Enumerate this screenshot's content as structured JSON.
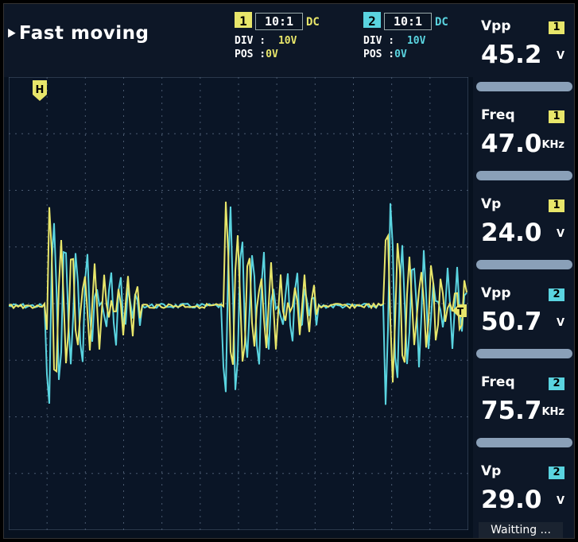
{
  "header": {
    "trigger_mode": "Fast moving",
    "channels": [
      {
        "id": "1",
        "probe": "10:1",
        "coupling": "DC",
        "div_label": "DIV :",
        "div_value": "10V",
        "pos_label": "POS :",
        "pos_value": "0V",
        "color": "#e8e66a"
      },
      {
        "id": "2",
        "probe": "10:1",
        "coupling": "DC",
        "div_label": "DIV :",
        "div_value": "10V",
        "pos_label": "POS :",
        "pos_value": "0V",
        "color": "#5ad4e0"
      }
    ]
  },
  "markers": {
    "horizontal": "H",
    "trigger": "T"
  },
  "measurements": [
    {
      "label": "Vpp",
      "channel": "1",
      "value": "45.2",
      "unit": "V",
      "color": "#e8e66a"
    },
    {
      "label": "Freq",
      "channel": "1",
      "value": "47.0",
      "unit": "KHz",
      "color": "#e8e66a"
    },
    {
      "label": "Vp",
      "channel": "1",
      "value": "24.0",
      "unit": "V",
      "color": "#e8e66a"
    },
    {
      "label": "Vpp",
      "channel": "2",
      "value": "50.7",
      "unit": "V",
      "color": "#5ad4e0"
    },
    {
      "label": "Freq",
      "channel": "2",
      "value": "75.7",
      "unit": "KHz",
      "color": "#5ad4e0"
    },
    {
      "label": "Vp",
      "channel": "2",
      "value": "29.0",
      "unit": "V",
      "color": "#5ad4e0"
    }
  ],
  "status": "Waitting ...",
  "colors": {
    "background": "#07111f",
    "grid": "#4a5a70",
    "ch1": "#e8e66a",
    "ch2": "#5ad4e0"
  }
}
